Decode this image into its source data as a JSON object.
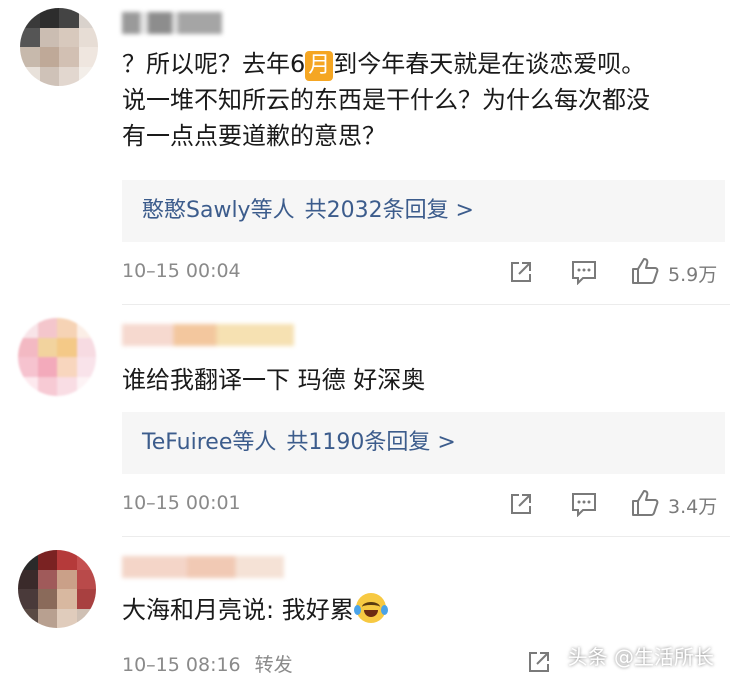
{
  "comments": [
    {
      "text_before_badge": "？所以呢？去年6",
      "badge": "月",
      "text_after_badge": "到今年春天就是在谈恋爱呗。",
      "line2": "说一堆不知所云的东西是干什么？为什么每次都没",
      "line3": "有一点点要道歉的意思？",
      "reply_users": "憨憨Sawly等人",
      "reply_count": "共2032条回复 >",
      "time": "10–15 00:04",
      "likes": "5.9万"
    },
    {
      "text": "谁给我翻译一下 玛德 好深奥",
      "reply_users": "TeFuiree等人",
      "reply_count": "共1190条回复 >",
      "time": "10–15 00:01",
      "likes": "3.4万"
    },
    {
      "text": "大海和月亮说: 我好累",
      "time": "10–15 08:16",
      "repost": "转发"
    }
  ],
  "watermark": "头条 @生活所长",
  "icons": {
    "share": "share-icon",
    "comment": "comment-icon",
    "like": "thumbs-up-icon",
    "emoji": "crying-laughing-emoji-icon"
  },
  "colors": {
    "link_blue": "#3c5c8c",
    "meta_gray": "#8a8a8a",
    "reply_bg": "#f6f6f6",
    "badge_orange": "#f5a623"
  }
}
